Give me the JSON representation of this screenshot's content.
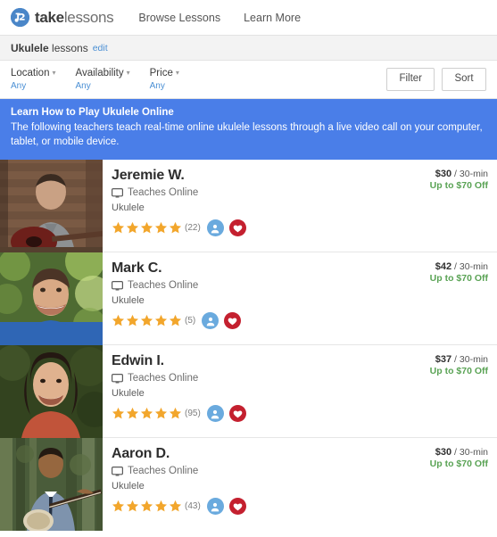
{
  "header": {
    "brand": {
      "bold": "take",
      "light": "lessons",
      "icon": "takelessons-logo-icon"
    },
    "nav": [
      {
        "label": "Browse Lessons",
        "name": "nav-browse-lessons"
      },
      {
        "label": "Learn More",
        "name": "nav-learn-more"
      }
    ]
  },
  "subhead": {
    "subject": "Ukulele",
    "suffix": " lessons",
    "edit_label": "edit"
  },
  "filterbar": {
    "filters": [
      {
        "label": "Location",
        "value": "Any"
      },
      {
        "label": "Availability",
        "value": "Any"
      },
      {
        "label": "Price",
        "value": "Any"
      }
    ],
    "filter_button": "Filter",
    "sort_button": "Sort"
  },
  "banner": {
    "title": "Learn How to Play Ukulele Online",
    "body": "The following teachers teach real-time online ukulele lessons through a live video call on your computer, tablet, or mobile device.",
    "background_color": "#4a7ee8"
  },
  "colors": {
    "accent_blue": "#4a8fd4",
    "banner_blue": "#4a7ee8",
    "star_orange": "#f2a62c",
    "discount_green": "#5aa355",
    "heart_red": "#c4202f",
    "person_badge_blue": "#6aaade"
  },
  "listings": [
    {
      "name": "Jeremie W.",
      "online_label": "Teaches Online",
      "subject": "Ukulele",
      "stars": 5,
      "review_count": "(22)",
      "price_amount": "$30",
      "price_unit": " / 30-min",
      "discount": "Up to $70 Off",
      "photo_alt": "man with acoustic guitar in front of brick wall"
    },
    {
      "name": "Mark C.",
      "online_label": "Teaches Online",
      "subject": "Ukulele",
      "stars": 5,
      "review_count": "(5)",
      "price_amount": "$42",
      "price_unit": " / 30-min",
      "discount": "Up to $70 Off",
      "photo_alt": "smiling man in blue shirt outdoors with green foliage"
    },
    {
      "name": "Edwin I.",
      "online_label": "Teaches Online",
      "subject": "Ukulele",
      "stars": 5,
      "review_count": "(95)",
      "price_amount": "$37",
      "price_unit": " / 30-min",
      "discount": "Up to $70 Off",
      "photo_alt": "smiling man with long dark hair in orange shirt"
    },
    {
      "name": "Aaron D.",
      "online_label": "Teaches Online",
      "subject": "Ukulele",
      "stars": 5,
      "review_count": "(43)",
      "price_amount": "$30",
      "price_unit": " / 30-min",
      "discount": "Up to $70 Off",
      "photo_alt": "man in blue shirt and tie holding a banjo outdoors"
    }
  ]
}
